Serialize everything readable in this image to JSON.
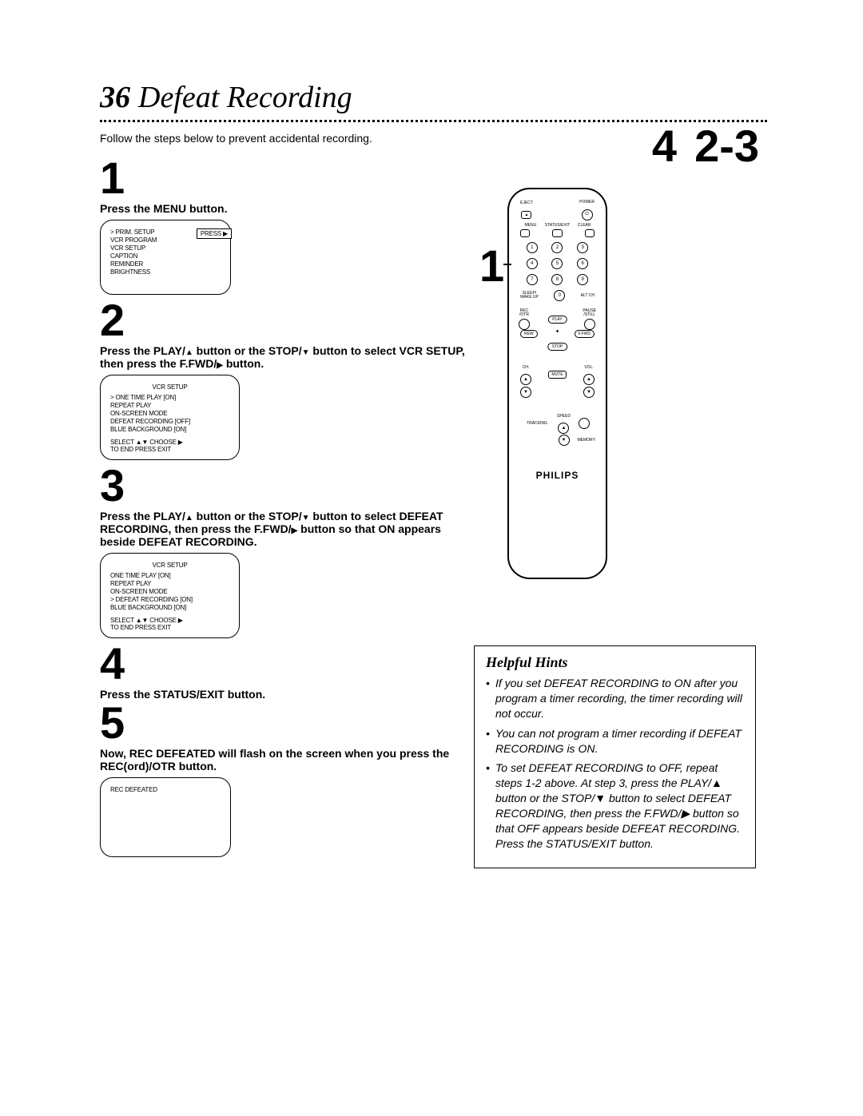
{
  "header": {
    "page_number": "36",
    "title": "Defeat Recording",
    "intro": "Follow the steps below to prevent accidental recording."
  },
  "callouts": {
    "top_left": "4",
    "top_right": "2-3",
    "side": "1"
  },
  "steps": {
    "s1": {
      "num": "1",
      "text": "Press the MENU button."
    },
    "s2": {
      "num": "2",
      "text_a": "Press the PLAY/",
      "text_b": " button or the STOP/",
      "text_c": " button to select VCR SETUP, then press the F.FWD/",
      "text_d": " button."
    },
    "s3": {
      "num": "3",
      "text_a": "Press the PLAY/",
      "text_b": " button or the STOP/",
      "text_c": " button to select DEFEAT RECORDING, then press the F.FWD/",
      "text_d": " button so that ON appears beside DEFEAT RECORDING."
    },
    "s4": {
      "num": "4",
      "text": "Press the STATUS/EXIT button."
    },
    "s5": {
      "num": "5",
      "text": "Now, REC DEFEATED will flash on the screen when you press the REC(ord)/OTR button."
    }
  },
  "screen1": {
    "press_label": "PRESS ▶",
    "lines": [
      "> PRIM. SETUP",
      "  VCR PROGRAM",
      "  VCR SETUP",
      "  CAPTION",
      "  REMINDER",
      "  BRIGHTNESS"
    ]
  },
  "screen2": {
    "title": "VCR SETUP",
    "lines": [
      "> ONE TIME PLAY       [ON]",
      "  REPEAT PLAY",
      "  ON-SCREEN MODE",
      "  DEFEAT RECORDING [OFF]",
      "  BLUE BACKGROUND  [ON]"
    ],
    "footer1": "SELECT ▲▼ CHOOSE ▶",
    "footer2": "TO END PRESS EXIT"
  },
  "screen3": {
    "title": "VCR SETUP",
    "lines": [
      "  ONE TIME PLAY       [ON]",
      "  REPEAT PLAY",
      "  ON-SCREEN MODE",
      "> DEFEAT RECORDING [ON]",
      "  BLUE BACKGROUND  [ON]"
    ],
    "footer1": "SELECT ▲▼ CHOOSE ▶",
    "footer2": "TO END PRESS EXIT"
  },
  "screen4": {
    "line": "REC DEFEATED"
  },
  "remote": {
    "eject": "EJECT",
    "power": "POWER",
    "menu": "MENU",
    "statusexit": "STATUS/EXIT",
    "clear": "CLEAR",
    "digits": [
      "1",
      "2",
      "3",
      "4",
      "5",
      "6",
      "7",
      "8",
      "9",
      "0"
    ],
    "sleep": "SLEEP/",
    "wakeup": "WAKE UP",
    "altch": "ALT CH",
    "rec": "REC",
    "otr": "/OTR",
    "pause": "PAUSE",
    "still": "/STILL",
    "play": "PLAY",
    "rew": "REW",
    "ffwd": "F.FWD",
    "stop": "STOP",
    "ch": "CH.",
    "vol": "VOL.",
    "mute": "MUTE",
    "speed": "SPEED",
    "tracking": "TRACKING",
    "memory": "MEMORY",
    "brand": "PHILIPS"
  },
  "hints": {
    "title": "Helpful Hints",
    "items": [
      "If you set DEFEAT RECORDING to ON after you program a timer recording, the timer recording will not occur.",
      "You can not program a timer recording if DEFEAT RECORDING is ON.",
      "To set DEFEAT RECORDING to OFF, repeat steps 1-2 above. At step 3, press the PLAY/▲ button or the STOP/▼ button to select DEFEAT RECORDING, then press the F.FWD/▶ button so that OFF appears beside DEFEAT RECORDING. Press the STATUS/EXIT button."
    ]
  }
}
